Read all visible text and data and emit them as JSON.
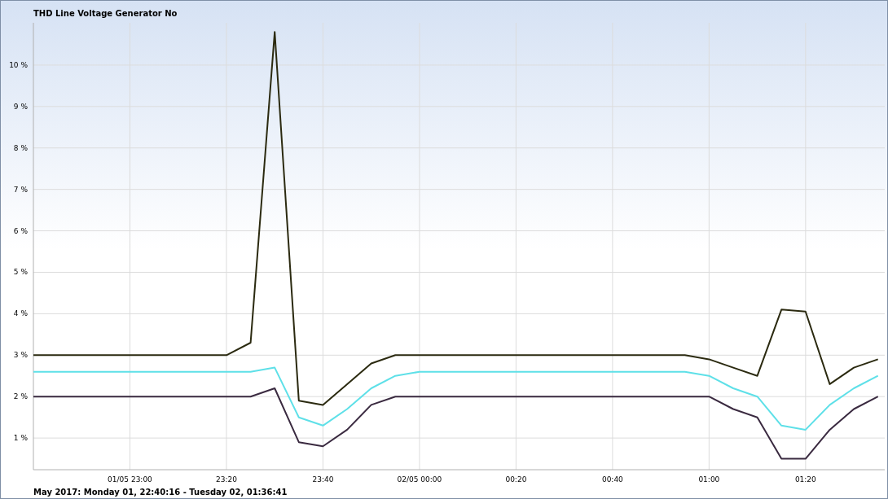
{
  "title": "THD Line Voltage Generator No",
  "chart_data": {
    "type": "line",
    "categories": [
      null,
      null,
      null,
      null,
      "01/05 23:00",
      null,
      null,
      null,
      "23:20",
      null,
      null,
      null,
      "23:40",
      null,
      null,
      null,
      "02/05 00:00",
      null,
      null,
      null,
      "00:20",
      null,
      null,
      null,
      "00:40",
      null,
      null,
      null,
      "01:00",
      null,
      null,
      null,
      "01:20",
      null,
      null,
      null
    ],
    "series": [
      {
        "color": "#2b2a10",
        "values": [
          3.0,
          3.0,
          3.0,
          3.0,
          3.0,
          3.0,
          3.0,
          3.0,
          3.0,
          3.3,
          10.8,
          1.9,
          1.8,
          2.3,
          2.8,
          3.0,
          3.0,
          3.0,
          3.0,
          3.0,
          3.0,
          3.0,
          3.0,
          3.0,
          3.0,
          3.0,
          3.0,
          3.0,
          2.9,
          2.7,
          2.5,
          4.1,
          4.05,
          2.3,
          2.7,
          2.9
        ]
      },
      {
        "color": "#3a2a40",
        "values": [
          2.0,
          2.0,
          2.0,
          2.0,
          2.0,
          2.0,
          2.0,
          2.0,
          2.0,
          2.0,
          2.2,
          0.9,
          0.8,
          1.2,
          1.8,
          2.0,
          2.0,
          2.0,
          2.0,
          2.0,
          2.0,
          2.0,
          2.0,
          2.0,
          2.0,
          2.0,
          2.0,
          2.0,
          2.0,
          1.7,
          1.5,
          0.5,
          0.5,
          1.2,
          1.7,
          2.0
        ]
      },
      {
        "color": "#5ee0e8",
        "values": [
          2.6,
          2.6,
          2.6,
          2.6,
          2.6,
          2.6,
          2.6,
          2.6,
          2.6,
          2.6,
          2.7,
          1.5,
          1.3,
          1.7,
          2.2,
          2.5,
          2.6,
          2.6,
          2.6,
          2.6,
          2.6,
          2.6,
          2.6,
          2.6,
          2.6,
          2.6,
          2.6,
          2.6,
          2.5,
          2.2,
          2.0,
          1.3,
          1.2,
          1.8,
          2.2,
          2.5
        ]
      }
    ],
    "grid": true,
    "ylim": [
      0.236,
      11.02
    ],
    "yticks": [
      {
        "value": 1,
        "label": "1 %"
      },
      {
        "value": 2,
        "label": "2 %"
      },
      {
        "value": 3,
        "label": "3 %"
      },
      {
        "value": 4,
        "label": "4 %"
      },
      {
        "value": 5,
        "label": "5 %"
      },
      {
        "value": 6,
        "label": "6 %"
      },
      {
        "value": 7,
        "label": "7 %"
      },
      {
        "value": 8,
        "label": "8 %"
      },
      {
        "value": 9,
        "label": "9 %"
      },
      {
        "value": 10,
        "label": "10 %"
      }
    ]
  },
  "footer": "May 2017: Monday 01, 22:40:16 - Tuesday 02, 01:36:41"
}
